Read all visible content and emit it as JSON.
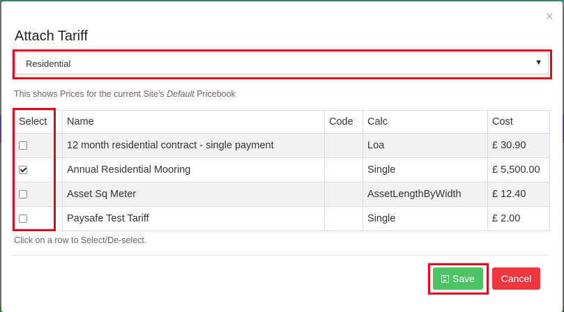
{
  "modal": {
    "title": "Attach Tariff",
    "close_glyph": "×",
    "close_icon": "close-icon"
  },
  "tariff_type_select": {
    "value": "Residential",
    "caret_glyph": "▼"
  },
  "info": {
    "prefix": "This shows Prices for the current Site's ",
    "emphasis": "Default",
    "suffix": " Pricebook"
  },
  "table": {
    "headers": [
      "Select",
      "Name",
      "Code",
      "Calc",
      "Cost"
    ],
    "rows": [
      {
        "selected": false,
        "name": "12 month residential contract - single payment",
        "code": "",
        "calc": "Loa",
        "cost": "£ 30.90"
      },
      {
        "selected": true,
        "name": "Annual Residential Mooring",
        "code": "",
        "calc": "Single",
        "cost": "£ 5,500.00"
      },
      {
        "selected": false,
        "name": "Asset Sq Meter",
        "code": "",
        "calc": "AssetLengthByWidth",
        "cost": "£ 12.40"
      },
      {
        "selected": false,
        "name": "Paysafe Test Tariff",
        "code": "",
        "calc": "Single",
        "cost": "£ 2.00"
      }
    ]
  },
  "help_text": "Click on a row to Select/De-select.",
  "buttons": {
    "save_label": "Save",
    "save_icon": "floppy-disk-icon",
    "cancel_label": "Cancel"
  },
  "colors": {
    "highlight": "#e3001b",
    "save": "#4cc465",
    "cancel": "#f0363f",
    "stripe": "#f2f2f2"
  }
}
